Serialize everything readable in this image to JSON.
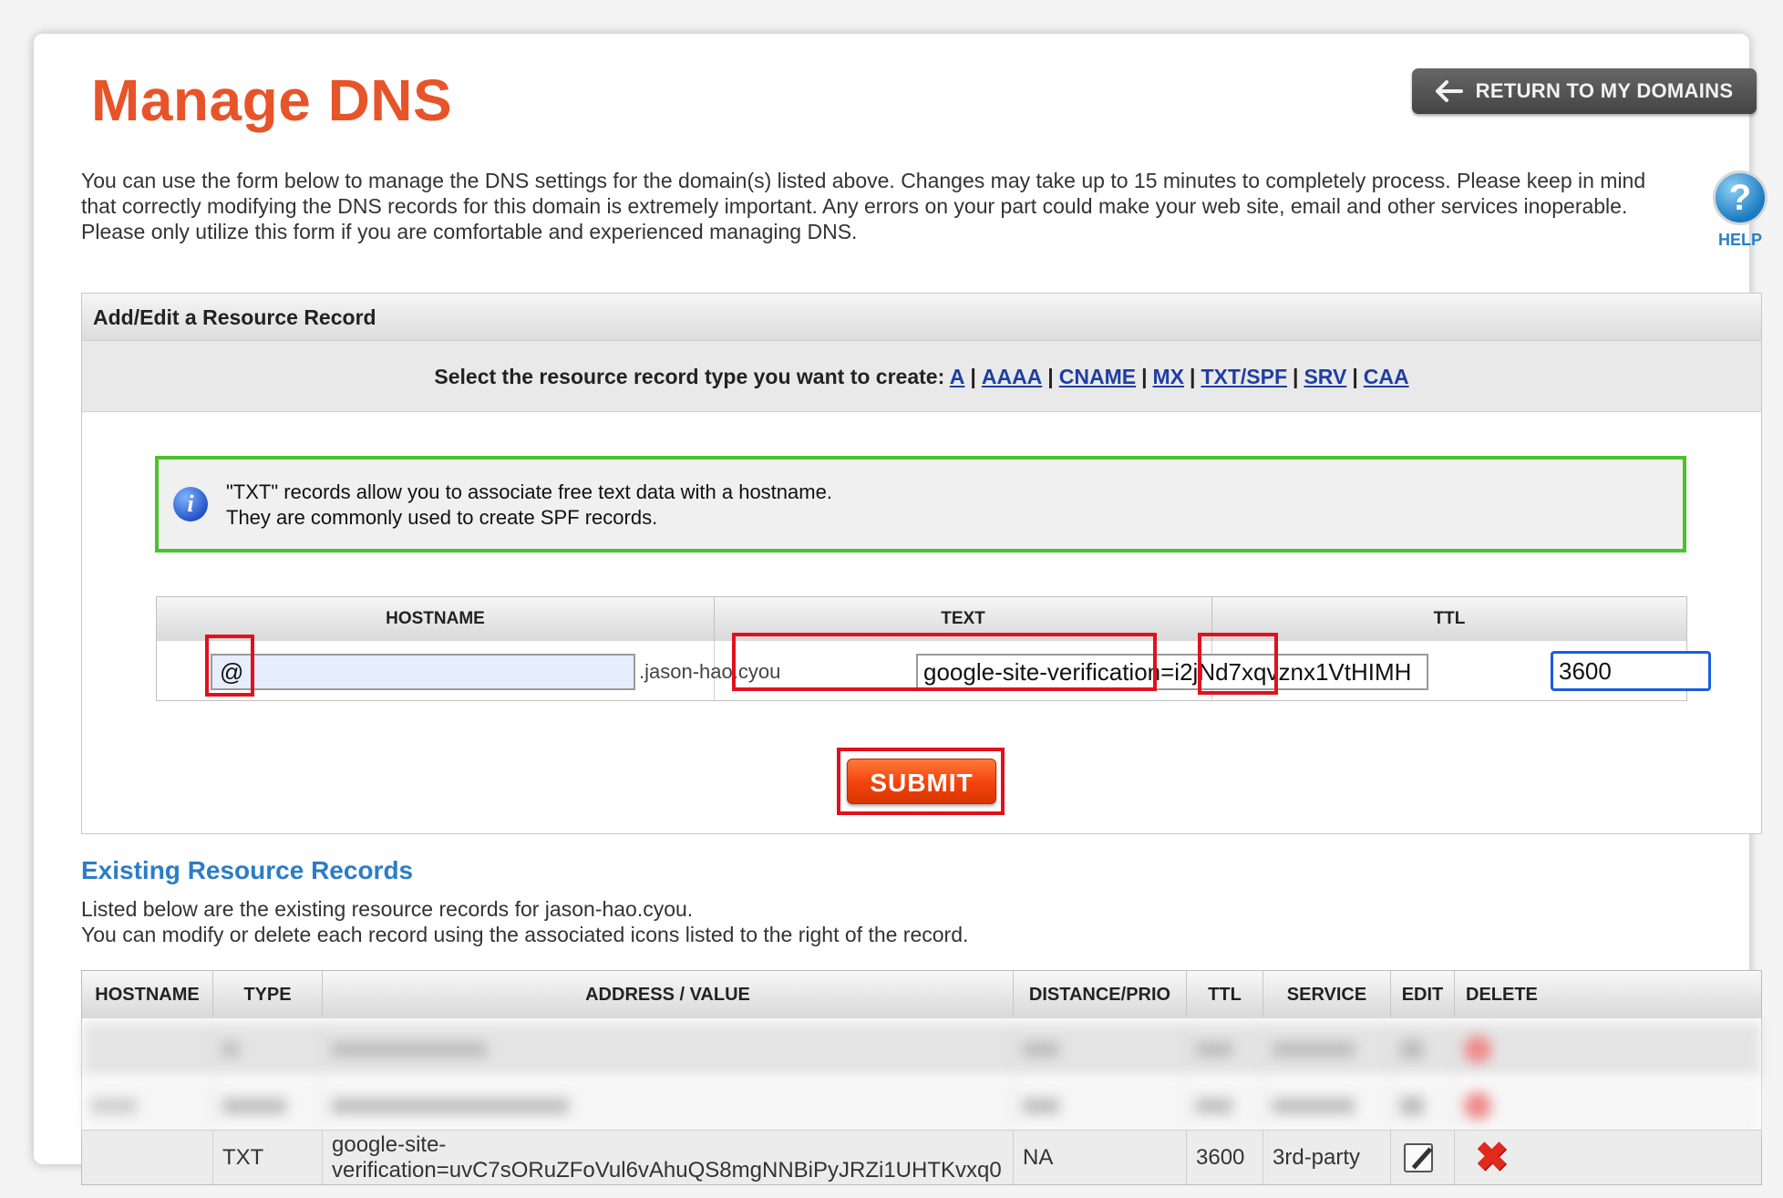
{
  "header": {
    "title": "Manage DNS",
    "return_button": "RETURN TO MY DOMAINS"
  },
  "intro": {
    "text": "You can use the form below to manage the DNS settings for the domain(s) listed above. Changes may take up to 15 minutes to completely process. Please keep in mind that correctly modifying the DNS records for this domain is extremely important. Any errors on your part could make your web site, email and other services inoperable. Please only utilize this form if you are comfortable and experienced managing DNS."
  },
  "help": {
    "label": "HELP",
    "icon": "question-icon"
  },
  "form": {
    "panel_title": "Add/Edit a Resource Record",
    "type_prompt": "Select the resource record type you want to create:",
    "record_types": [
      "A",
      "AAAA",
      "CNAME",
      "MX",
      "TXT/SPF",
      "SRV",
      "CAA"
    ],
    "info": {
      "icon": "info-icon",
      "line1": "\"TXT\" records allow you to associate free text data with a hostname.",
      "line2": "They are commonly used to create SPF records."
    },
    "columns": {
      "hostname": "HOSTNAME",
      "text": "TEXT",
      "ttl": "TTL"
    },
    "hostname_value": "@",
    "domain_suffix": ".jason-hao.cyou",
    "text_value": "google-site-verification=i2jNd7xqvznx1VtHIMH",
    "ttl_value": "3600",
    "submit_label": "SUBMIT",
    "highlight_color": "#e0111d",
    "info_border_color": "#4ac22c"
  },
  "existing": {
    "title": "Existing Resource Records",
    "desc_line1": "Listed below are the existing resource records for jason-hao.cyou.",
    "desc_line2": "You can modify or delete each record using the associated icons listed to the right of the record.",
    "columns": [
      "HOSTNAME",
      "TYPE",
      "ADDRESS / VALUE",
      "DISTANCE/PRIO",
      "TTL",
      "SERVICE",
      "EDIT",
      "DELETE"
    ],
    "visible_record": {
      "hostname": "",
      "type": "TXT",
      "value": "google-site-verification=uvC7sORuZFoVul6vAhuQS8mgNNBiPyJRZi1UHTKvxq0",
      "prio": "NA",
      "ttl": "3600",
      "service": "3rd-party"
    },
    "blurred_rows": 2
  }
}
